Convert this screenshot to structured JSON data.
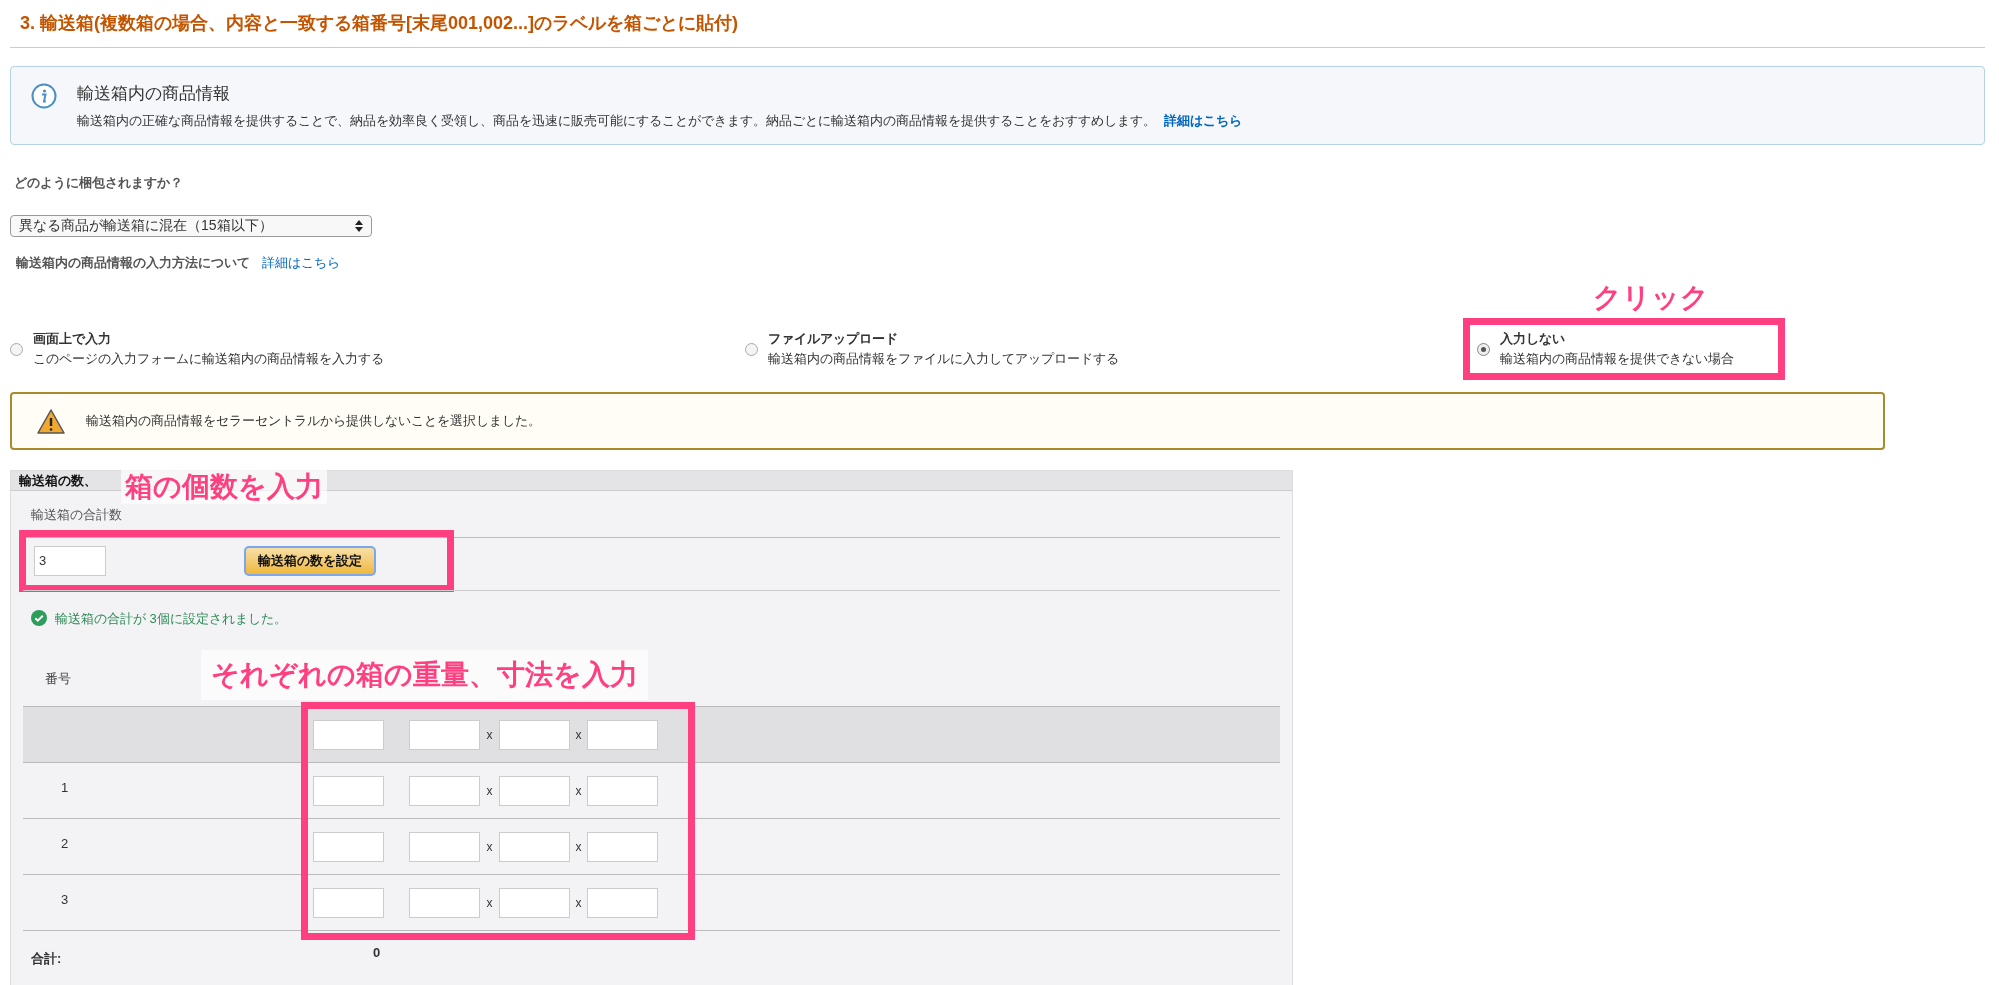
{
  "section_title": "3. 輸送箱(複数箱の場合、内容と一致する箱番号[末尾001,002...]のラベルを箱ごとに貼付)",
  "info": {
    "title": "輸送箱内の商品情報",
    "text": "輸送箱内の正確な商品情報を提供することで、納品を効率良く受領し、商品を迅速に販売可能にすることができます。納品ごとに輸送箱内の商品情報を提供することをおすすめします。",
    "link": "詳細はこちら"
  },
  "packing_question": "どのように梱包されますか？",
  "packing_select": {
    "value": "異なる商品が輸送箱に混在（15箱以下）"
  },
  "input_method": {
    "label": "輸送箱内の商品情報の入力方法について",
    "link": "詳細はこちら"
  },
  "options": [
    {
      "title": "画面上で入力",
      "description": "このページの入力フォームに輸送箱内の商品情報を入力する",
      "selected": false
    },
    {
      "title": "ファイルアップロード",
      "description": "輸送箱内の商品情報をファイルに入力してアップロードする",
      "selected": false
    },
    {
      "title": "入力しない",
      "description": "輸送箱内の商品情報を提供できない場合",
      "selected": true
    }
  ],
  "warning": "輸送箱内の商品情報をセラーセントラルから提供しないことを選択しました。",
  "boxes_panel": {
    "header": "輸送箱の数、",
    "count_label": "輸送箱の合計数",
    "count_value": "3",
    "set_button": "輸送箱の数を設定",
    "success": "輸送箱の合計が 3個に設定されました。",
    "number_column": "番号",
    "rows": [
      {
        "kind": "all",
        "separators": [
          "x",
          "x"
        ]
      },
      {
        "kind": "box",
        "number": "1",
        "separators": [
          "x",
          "x"
        ]
      },
      {
        "kind": "box",
        "number": "2",
        "separators": [
          "x",
          "x"
        ]
      },
      {
        "kind": "box",
        "number": "3",
        "separators": [
          "x",
          "x"
        ]
      }
    ],
    "total": {
      "label": "合計:",
      "value": "0"
    }
  },
  "annotations": {
    "click": "クリック",
    "count": "箱の個数を入力",
    "dimensions": "それぞれの箱の重量、寸法を入力"
  }
}
